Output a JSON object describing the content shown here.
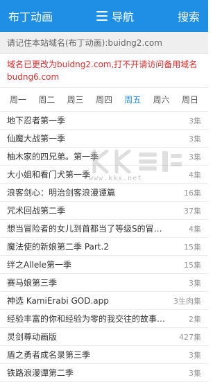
{
  "header": {
    "brand": "布丁动画",
    "nav_label": "导航",
    "search_label": "搜索",
    "bg": "#1e8fe5"
  },
  "notices": {
    "domain_hint": "请记住本站域名(布丁动画):buidng2.com",
    "changed_domain": "域名已更改为buidng2.com,打不开请访问备用域名budng6.com"
  },
  "weekdays": [
    "周一",
    "周二",
    "周三",
    "周四",
    "周五",
    "周六",
    "周日"
  ],
  "active_weekday": "周五",
  "anime_list": [
    {
      "title": "地下忍者第一季",
      "count": "3集"
    },
    {
      "title": "仙魔大战第一季",
      "count": "3集"
    },
    {
      "title": "柚木家的四兄弟。第一季",
      "count": "3集"
    },
    {
      "title": "大小姐和看门犬第一季",
      "count": "4集"
    },
    {
      "title": "浪客剑心：明治剑客浪漫谭篇",
      "count": "16集"
    },
    {
      "title": "咒术回战第二季",
      "count": "37集"
    },
    {
      "title": "想当冒险者的女儿到首都当了等级S的冒险者",
      "count": "4集"
    },
    {
      "title": "魔法使的新娘第二季 Part.2",
      "count": "15集"
    },
    {
      "title": "绊之Allele第一季",
      "count": "15集"
    },
    {
      "title": "赛马娘第三季",
      "count": "3集"
    },
    {
      "title": "神选 KamiErabi GOD.app",
      "count": "3生肉集"
    },
    {
      "title": "经验丰富的你和经验为零的我交往的故事第一",
      "count": "2集"
    },
    {
      "title": "灵剑尊动画版",
      "count": "427集"
    },
    {
      "title": "盾之勇者成名录第三季",
      "count": "3集"
    },
    {
      "title": "铁路浪漫谭第二季",
      "count": "3集"
    }
  ],
  "watermark": {
    "text": "www.kkx.net",
    "icon_name": "download-site-watermark-icon"
  }
}
